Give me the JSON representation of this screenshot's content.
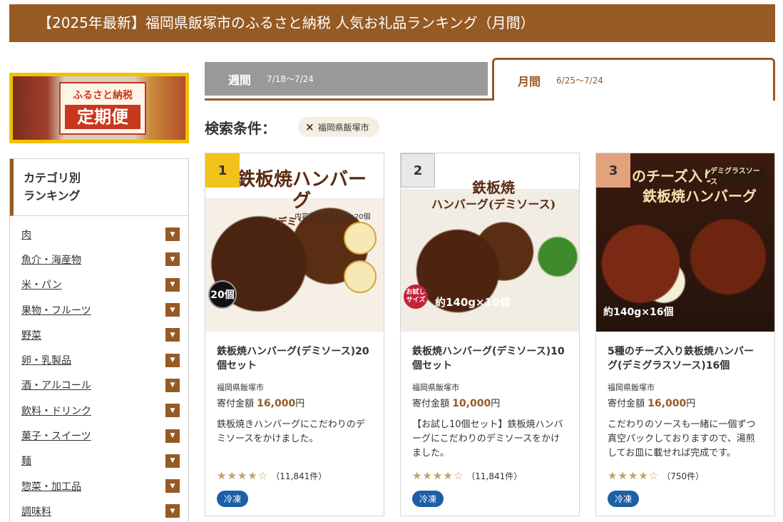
{
  "header": {
    "title": "【2025年最新】福岡県飯塚市のふるさと納税 人気お礼品ランキング（月間）"
  },
  "banner": {
    "small_text": "ふるさと納税",
    "big_text": "定期便"
  },
  "sidebar": {
    "title_line1": "カテゴリ別",
    "title_line2": "ランキング",
    "items": [
      {
        "label": "肉"
      },
      {
        "label": "魚介・海産物"
      },
      {
        "label": "米・パン"
      },
      {
        "label": "果物・フルーツ"
      },
      {
        "label": "野菜"
      },
      {
        "label": "卵・乳製品"
      },
      {
        "label": "酒・アルコール"
      },
      {
        "label": "飲料・ドリンク"
      },
      {
        "label": "菓子・スイーツ"
      },
      {
        "label": "麺"
      },
      {
        "label": "惣菜・加工品"
      },
      {
        "label": "調味料"
      }
    ],
    "arrow_icon": "triangle-down-icon"
  },
  "tabs": {
    "week": {
      "label": "週間",
      "range": "7/18〜7/24"
    },
    "month": {
      "label": "月間",
      "range": "6/25〜7/24"
    }
  },
  "search": {
    "label": "検索条件：",
    "chip": "福岡県飯塚市"
  },
  "accent_color": "#965a25",
  "products": [
    {
      "rank": "1",
      "image_title": "鉄板焼ハンバーグ",
      "image_title2": "(デミソース)",
      "image_sub": "内容量：約140g×20個",
      "image_badge": "20個",
      "title": "鉄板焼ハンバーグ(デミソース)20個セット",
      "city": "福岡県飯塚市",
      "price_label": "寄付金額",
      "price": "16,000",
      "currency": "円",
      "description": "鉄板焼きハンバーグにこだわりのデミソースをかけました。",
      "stars": "★★★★☆",
      "rating": 4.5,
      "review_count": "（11,841件）",
      "tag": "冷凍"
    },
    {
      "rank": "2",
      "image_title": "鉄板焼",
      "image_title2": "ハンバーグ(デミソース)",
      "image_sub": "約140g×10個",
      "image_badge": "お試しサイズ",
      "title": "鉄板焼ハンバーグ(デミソース)10個セット",
      "city": "福岡県飯塚市",
      "price_label": "寄付金額",
      "price": "10,000",
      "currency": "円",
      "description": "【お試し10個セット】鉄板焼ハンバーグにこだわりのデミソースをかけました。",
      "stars": "★★★★☆",
      "rating": 4.5,
      "review_count": "（11,841件）",
      "tag": "冷凍"
    },
    {
      "rank": "3",
      "image_title": "のチーズ入り",
      "image_title2": "鉄板焼ハンバーグ",
      "image_sub": "約140g×16個",
      "image_badge": "デミグラスソース",
      "title": "5種のチーズ入り鉄板焼ハンバーグ(デミグラスソース)16個",
      "city": "福岡県飯塚市",
      "price_label": "寄付金額",
      "price": "16,000",
      "currency": "円",
      "description": "こだわりのソースも一緒に一個ずつ真空パックしておりますので、湯煎してお皿に載せれば完成です。",
      "stars": "★★★★☆",
      "rating": 4.5,
      "review_count": "（750件）",
      "tag": "冷凍"
    }
  ]
}
